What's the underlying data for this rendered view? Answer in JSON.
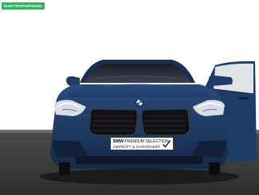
{
  "badge": {
    "label": "ELEKTROFAHRZEUG",
    "color": "#2fb45c"
  },
  "plate": {
    "brand": "BMW",
    "line1_rest": "PREMIUM SELECTION",
    "line2": "GEPRÜFT & GARANTIERT",
    "icon": "checkmark-icon"
  },
  "car": {
    "color": "#1f3a63"
  }
}
